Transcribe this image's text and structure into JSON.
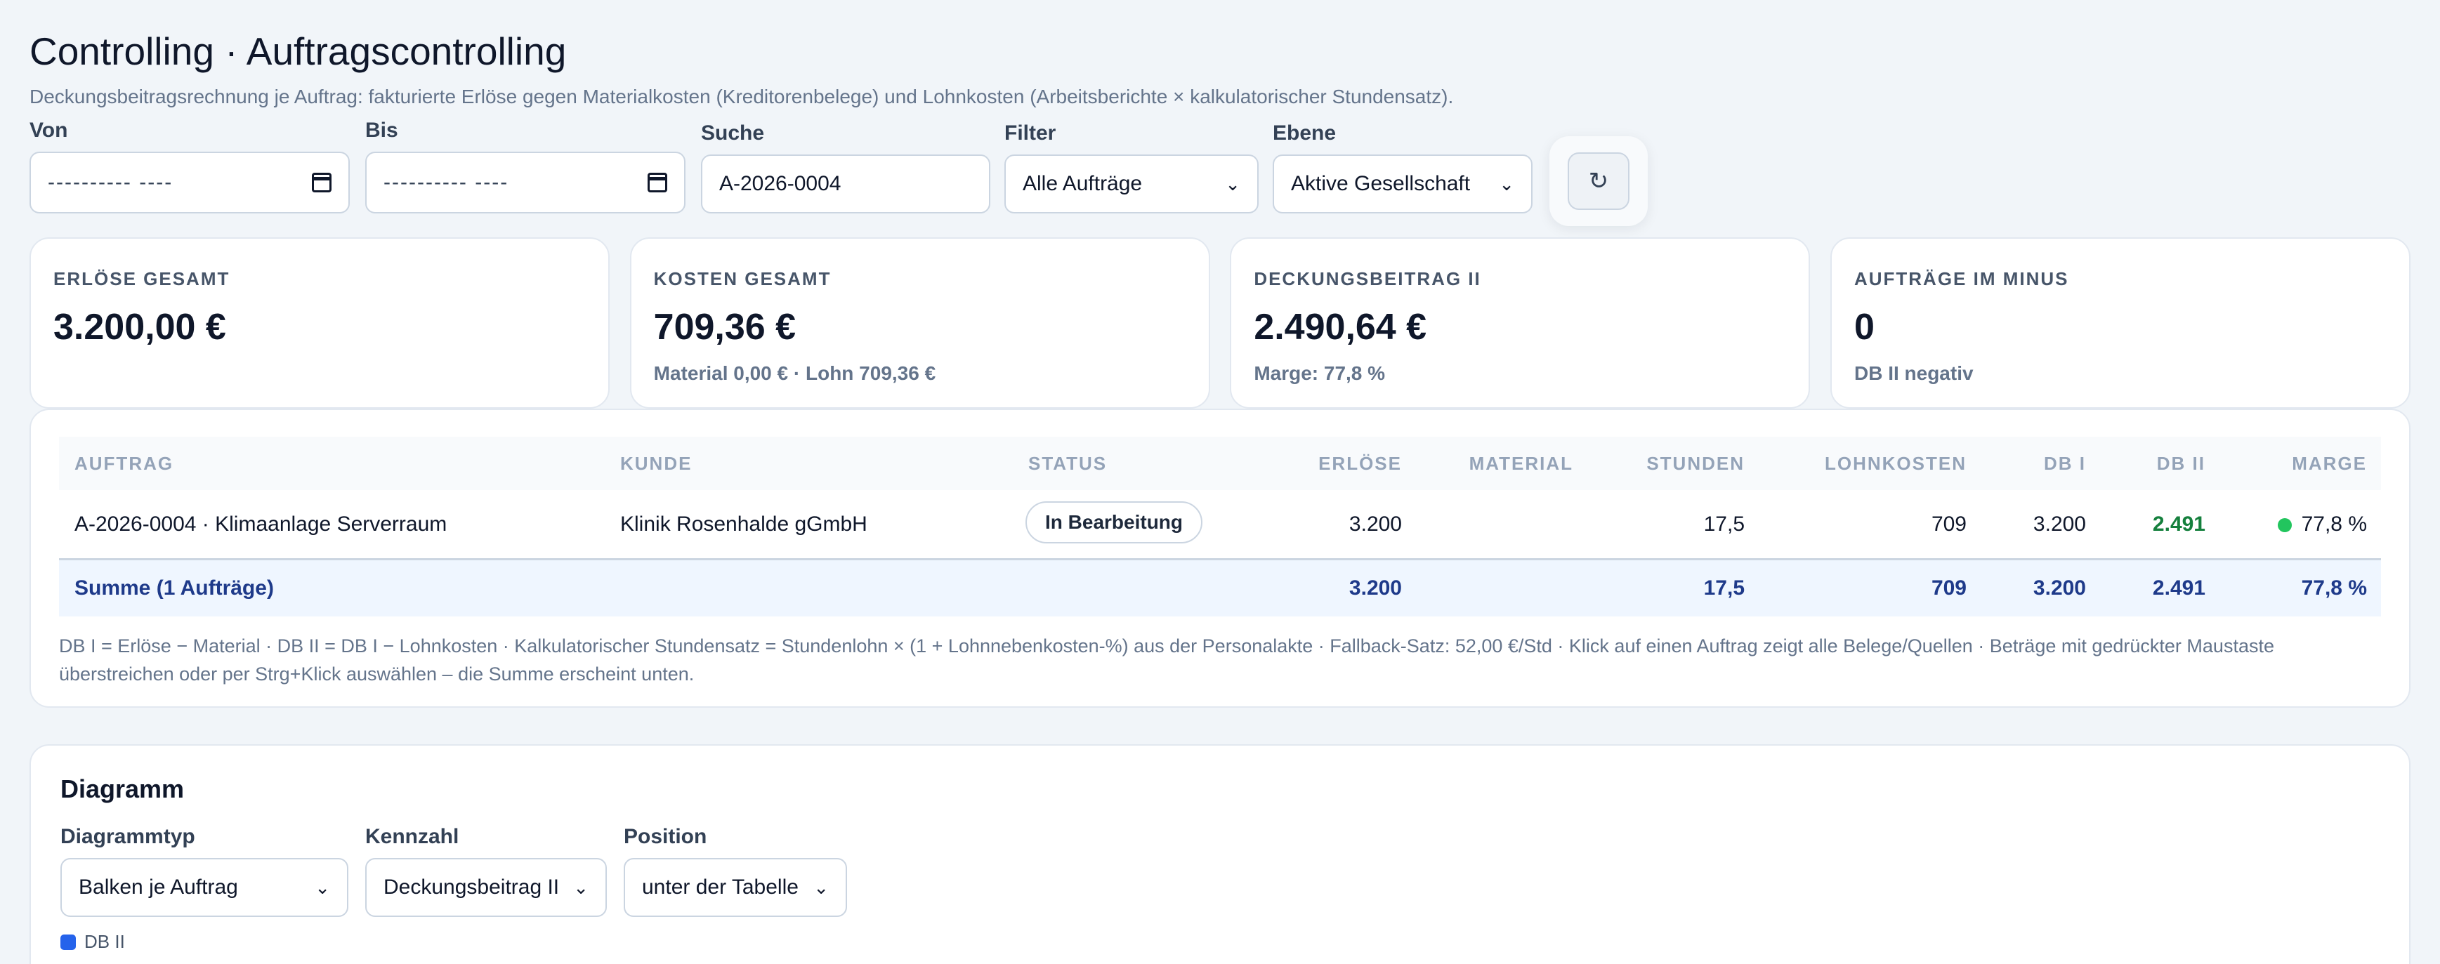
{
  "page": {
    "title": "Controlling · Auftragscontrolling",
    "subtitle": "Deckungsbeitragsrechnung je Auftrag: fakturierte Erlöse gegen Materialkosten (Kreditorenbelege) und Lohnkosten (Arbeitsberichte × kalkulatorischer Stundensatz)."
  },
  "filters": {
    "von": {
      "label": "Von",
      "value": "---------- ----"
    },
    "bis": {
      "label": "Bis",
      "value": "---------- ----"
    },
    "suche": {
      "label": "Suche",
      "value": "A-2026-0004"
    },
    "filter": {
      "label": "Filter",
      "value": "Alle Aufträge"
    },
    "ebene": {
      "label": "Ebene",
      "value": "Aktive Gesellschaft"
    },
    "refresh_icon": "↻"
  },
  "kpis": [
    {
      "label": "ERLÖSE GESAMT",
      "value": "3.200,00 €",
      "sub": ""
    },
    {
      "label": "KOSTEN GESAMT",
      "value": "709,36 €",
      "sub": "Material 0,00 € · Lohn 709,36 €"
    },
    {
      "label": "DECKUNGSBEITRAG II",
      "value": "2.490,64 €",
      "sub": "Marge: 77,8 %"
    },
    {
      "label": "AUFTRÄGE IM MINUS",
      "value": "0",
      "sub": "DB II negativ"
    }
  ],
  "table": {
    "headers": {
      "auftrag": "AUFTRAG",
      "kunde": "KUNDE",
      "status": "STATUS",
      "erloese": "ERLÖSE",
      "material": "MATERIAL",
      "stunden": "STUNDEN",
      "lohnkosten": "LOHNKOSTEN",
      "db1": "DB I",
      "db2": "DB II",
      "marge": "MARGE"
    },
    "rows": [
      {
        "auftrag": "A-2026-0004 · Klimaanlage Serverraum",
        "kunde": "Klinik Rosenhalde gGmbH",
        "status": "In Bearbeitung",
        "erloese": "3.200",
        "material": "",
        "stunden": "17,5",
        "lohnkosten": "709",
        "db1": "3.200",
        "db2": "2.491",
        "marge": "77,8 %",
        "marge_color": "#22c55e"
      }
    ],
    "sum": {
      "label": "Summe (1 Aufträge)",
      "erloese": "3.200",
      "material": "",
      "stunden": "17,5",
      "lohnkosten": "709",
      "db1": "3.200",
      "db2": "2.491",
      "marge": "77,8 %"
    },
    "note": "DB I = Erlöse − Material · DB II = DB I − Lohnkosten · Kalkulatorischer Stundensatz = Stundenlohn × (1 + Lohnnebenkosten-%) aus der Personalakte · Fallback-Satz: 52,00 €/Std · Klick auf einen Auftrag zeigt alle Belege/Quellen · Beträge mit gedrückter Maustaste überstreichen oder per Strg+Klick auswählen – die Summe erscheint unten."
  },
  "chart": {
    "title": "Diagramm",
    "typ": {
      "label": "Diagrammtyp",
      "value": "Balken je Auftrag"
    },
    "kennzahl": {
      "label": "Kennzahl",
      "value": "Deckungsbeitrag II"
    },
    "position": {
      "label": "Position",
      "value": "unter der Tabelle"
    },
    "legend": "DB II",
    "legend_color": "#2563eb"
  }
}
